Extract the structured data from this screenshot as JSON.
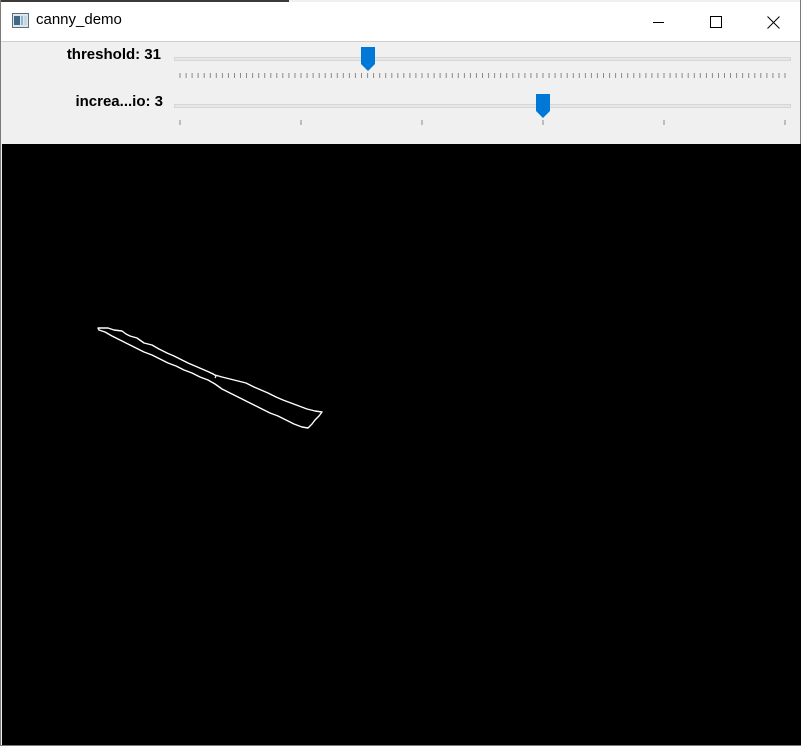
{
  "window": {
    "title": "canny_demo",
    "icon": "opencv-window-icon"
  },
  "title_buttons": {
    "minimize_icon": "minimize-icon",
    "maximize_icon": "maximize-icon",
    "close_icon": "close-icon"
  },
  "trackbars": [
    {
      "label": "threshold: 31",
      "value": 31,
      "max": 100
    },
    {
      "label": "increa...io: 3",
      "value": 3,
      "max": 5
    }
  ],
  "colors": {
    "thumb": "#0078d7",
    "canvas_background": "#000000",
    "edge_stroke": "#ffffff",
    "toolbar_background": "#f0f0f0"
  }
}
